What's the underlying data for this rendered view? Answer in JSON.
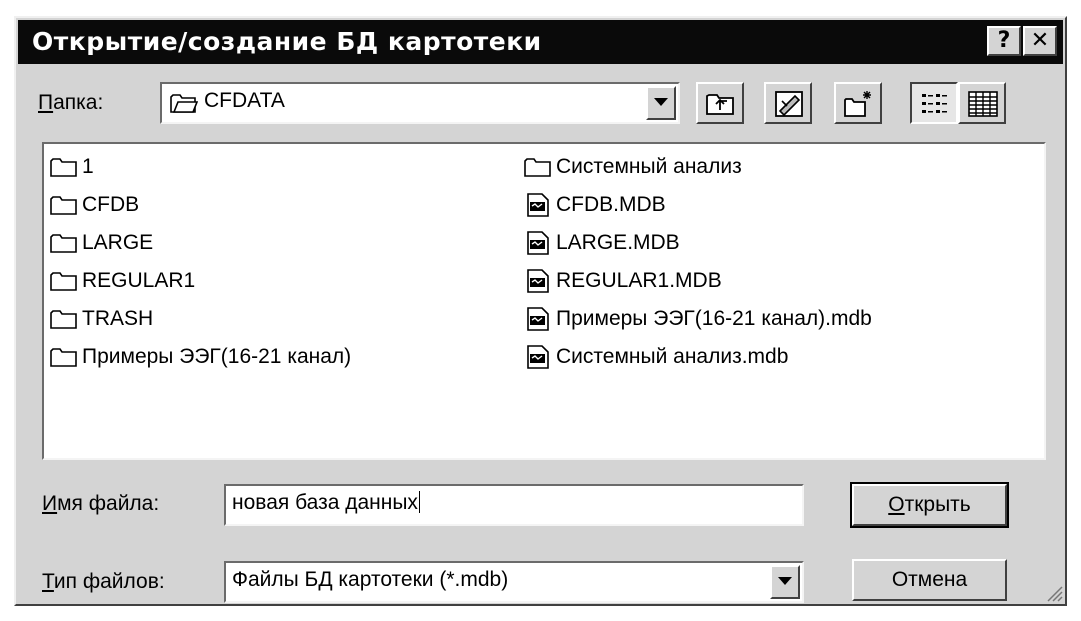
{
  "window": {
    "title": "Открытие/создание БД картотеки",
    "help_glyph": "?",
    "close_glyph": "✕"
  },
  "folder": {
    "label_accel": "П",
    "label_rest": "апка:",
    "value": "CFDATA",
    "icon": "folder-icon"
  },
  "toolbar": [
    {
      "name": "up-one-level-button",
      "icon": "folder-up-icon"
    },
    {
      "name": "desktop-button",
      "icon": "desktop-icon"
    },
    {
      "name": "new-folder-button",
      "icon": "new-folder-icon"
    },
    {
      "name": "list-view-button",
      "icon": "list-view-icon",
      "pressed": true
    },
    {
      "name": "details-view-button",
      "icon": "details-view-icon"
    }
  ],
  "files": {
    "left_column": [
      {
        "name": "1",
        "type": "folder"
      },
      {
        "name": "CFDB",
        "type": "folder"
      },
      {
        "name": "LARGE",
        "type": "folder"
      },
      {
        "name": "REGULAR1",
        "type": "folder"
      },
      {
        "name": "TRASH",
        "type": "folder"
      },
      {
        "name": "Примеры ЭЭГ(16-21 канал)",
        "type": "folder"
      }
    ],
    "right_column": [
      {
        "name": "Системный анализ",
        "type": "folder"
      },
      {
        "name": "CFDB.MDB",
        "type": "mdb"
      },
      {
        "name": "LARGE.MDB",
        "type": "mdb"
      },
      {
        "name": "REGULAR1.MDB",
        "type": "mdb"
      },
      {
        "name": "Примеры ЭЭГ(16-21 канал).mdb",
        "type": "mdb"
      },
      {
        "name": "Системный анализ.mdb",
        "type": "mdb"
      }
    ]
  },
  "filename": {
    "label_accel": "И",
    "label_rest": "мя файла:",
    "value": "новая база данных"
  },
  "filetype": {
    "label_accel": "Т",
    "label_rest": "ип файлов:",
    "value": "Файлы БД картотеки (*.mdb)"
  },
  "buttons": {
    "open_accel": "О",
    "open_rest": "ткрыть",
    "cancel": "Отмена"
  },
  "colors": {
    "titlebar": "#0a0a0a",
    "face": "#d4d4d4",
    "window": "#ffffff"
  }
}
